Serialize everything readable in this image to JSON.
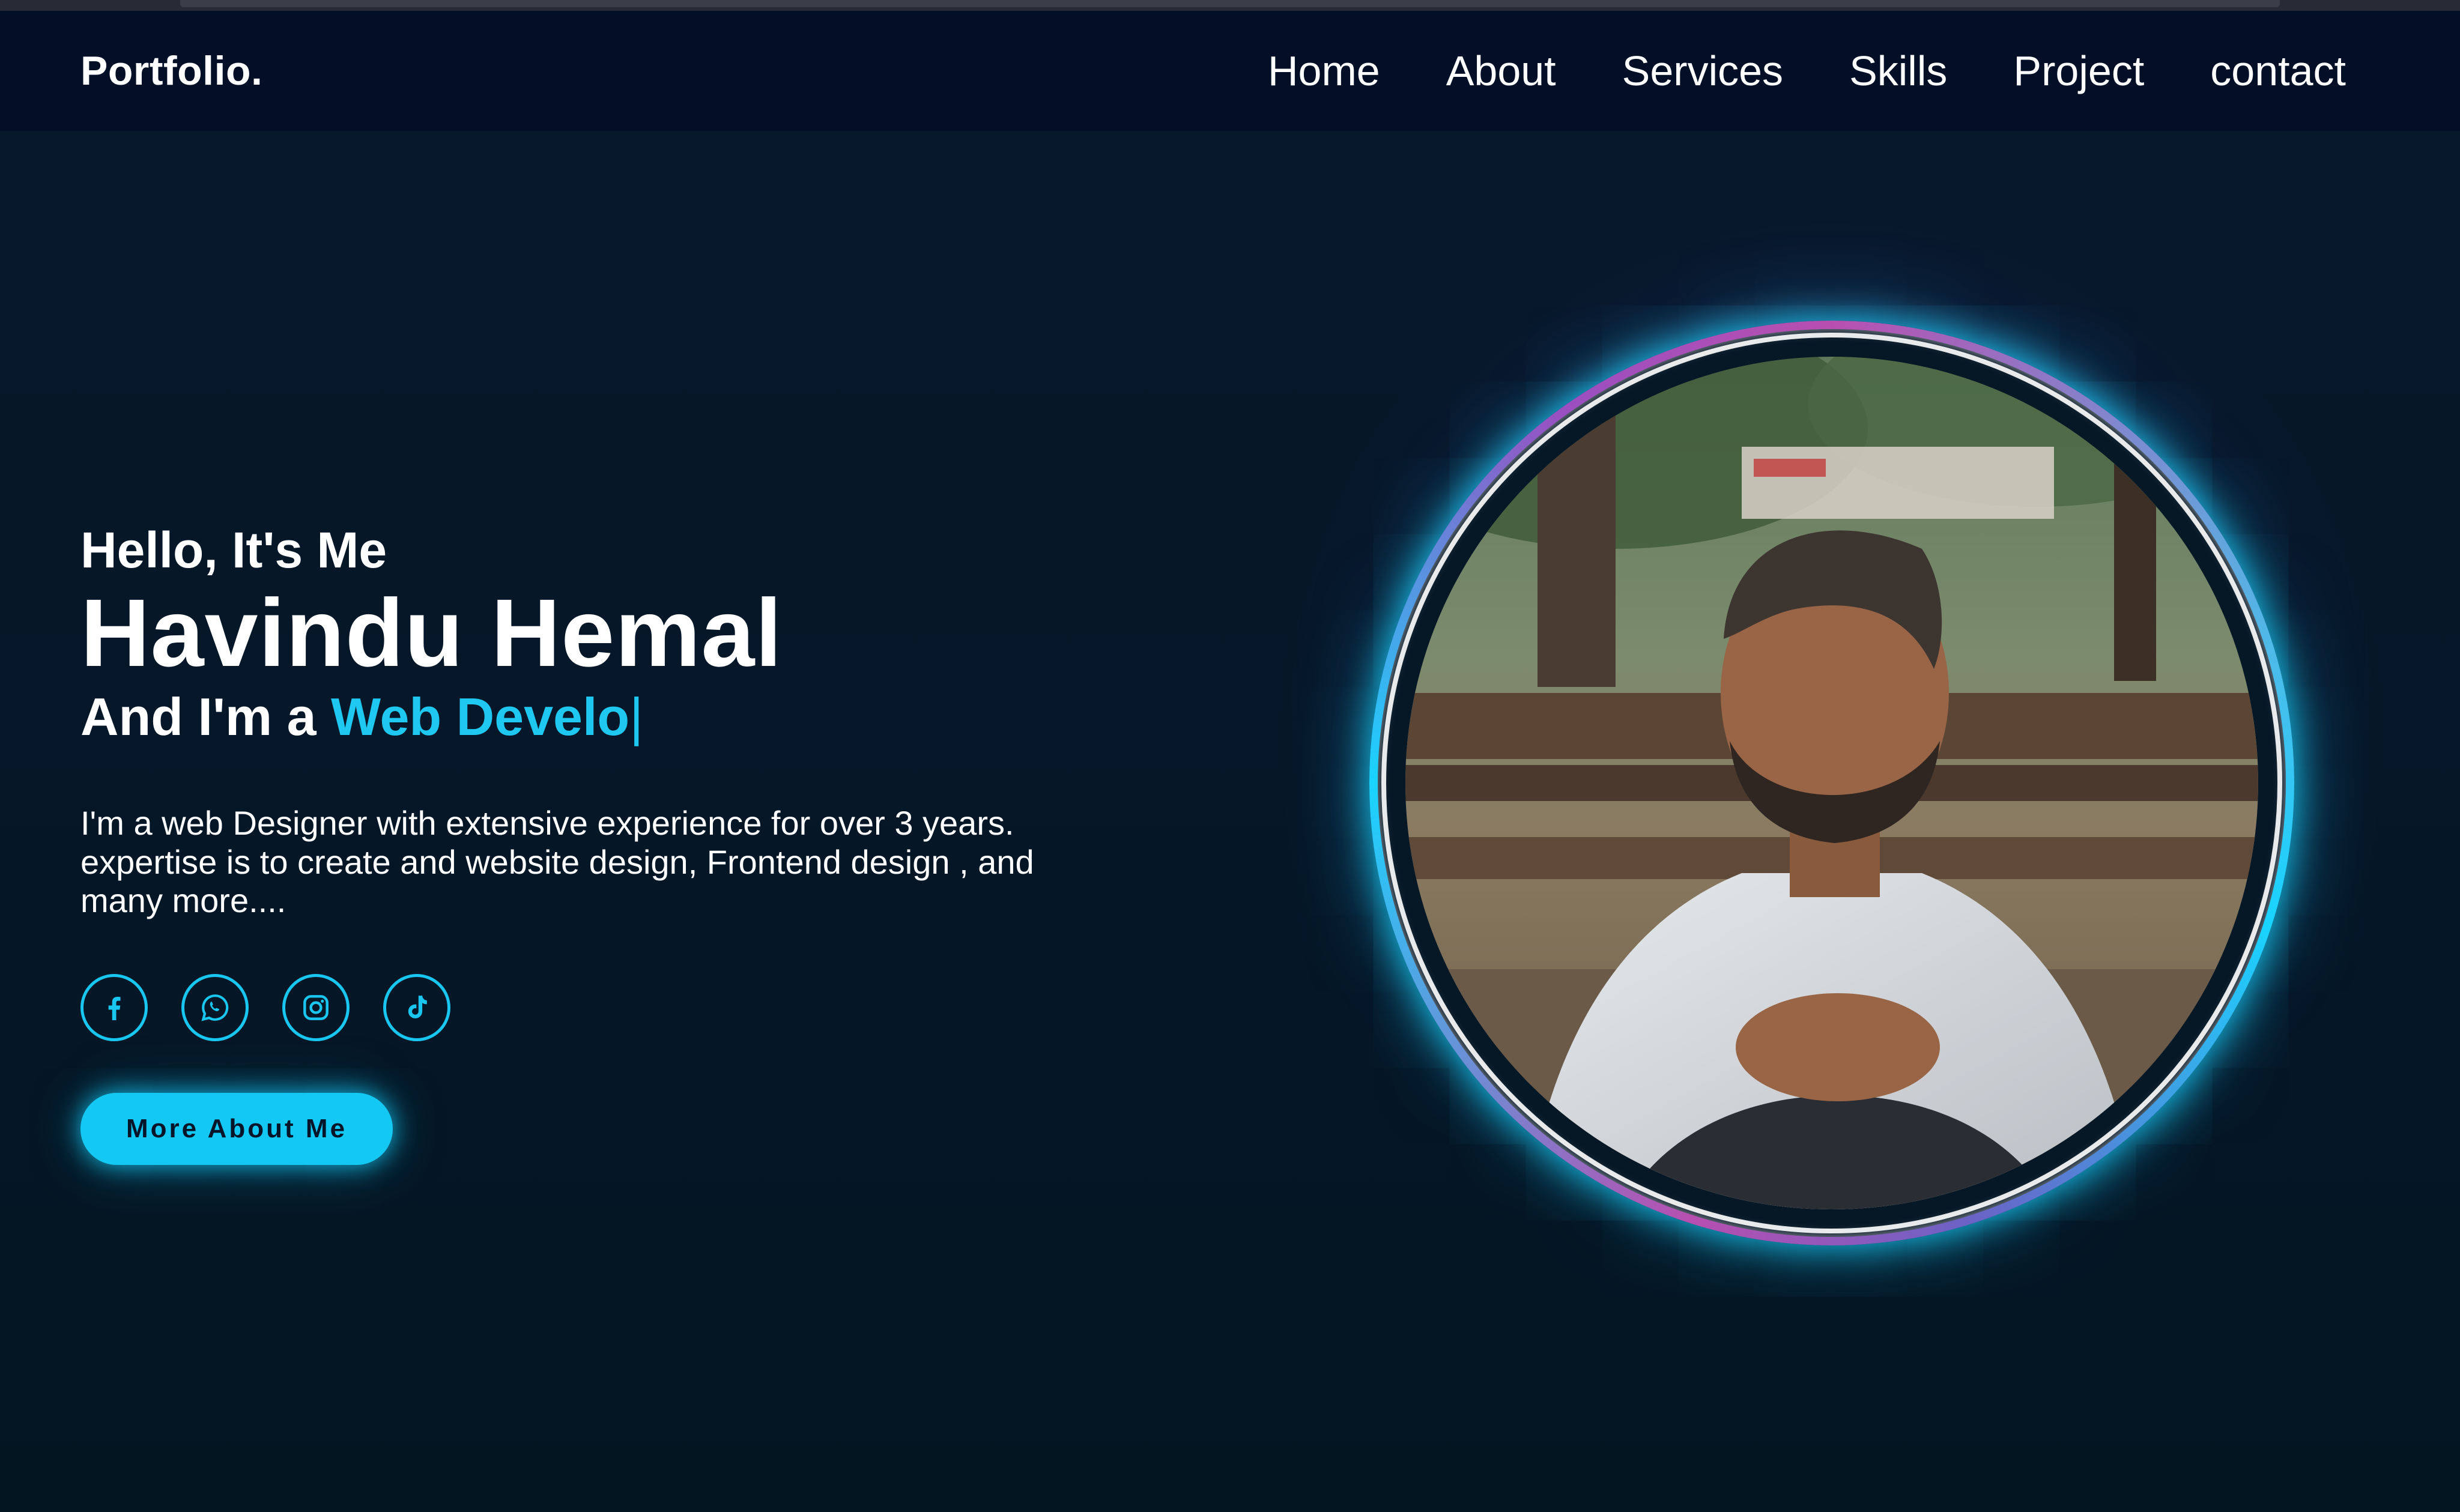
{
  "header": {
    "logo": "Portfolio.",
    "nav": [
      {
        "label": "Home"
      },
      {
        "label": "About"
      },
      {
        "label": "Services"
      },
      {
        "label": "Skills"
      },
      {
        "label": "Project"
      },
      {
        "label": "contact"
      }
    ]
  },
  "hero": {
    "greeting": "Hello, It's Me",
    "name": "Havindu Hemal",
    "role_prefix": "And I'm a",
    "role_typed": "Web Develo",
    "cursor": "|",
    "description": "I'm a web Designer with extensive experience for over 3 years. expertise is to create and website design, Frontend design , and many more....",
    "socials": [
      {
        "icon": "facebook-icon"
      },
      {
        "icon": "whatsapp-icon"
      },
      {
        "icon": "instagram-icon"
      },
      {
        "icon": "tiktok-icon"
      }
    ],
    "cta_label": "More About Me"
  },
  "colors": {
    "accent": "#19c6ef",
    "background": "#061726",
    "header_bg": "#020f26",
    "ring_pink": "#b84fb0"
  }
}
